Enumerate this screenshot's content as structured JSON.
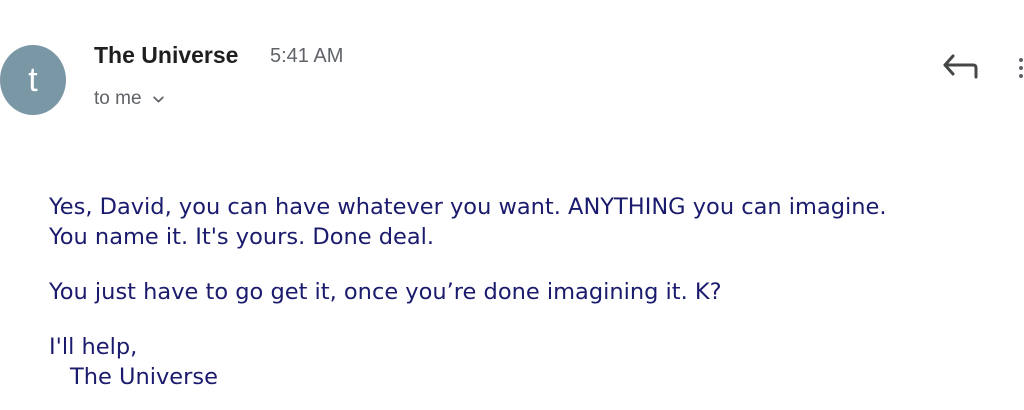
{
  "header": {
    "avatar_letter": "t",
    "avatar_color": "#7a97a6",
    "sender_name": "The Universe",
    "time": "5:41 AM",
    "recipient": "to me",
    "recipient_icon": "chevron-down-icon",
    "reply_icon": "reply-icon",
    "more_icon": "more-vertical-icon"
  },
  "message": {
    "text_color": "#1b1b6e",
    "paragraph1_line1": "Yes, David, you can have whatever you want. ANYTHING you can imagine.",
    "paragraph1_line2": "You name it. It's yours. Done deal.",
    "paragraph2": "You just have to go get it, once you’re done imagining it. K?",
    "closing": "I'll help,",
    "signature": "The Universe"
  }
}
